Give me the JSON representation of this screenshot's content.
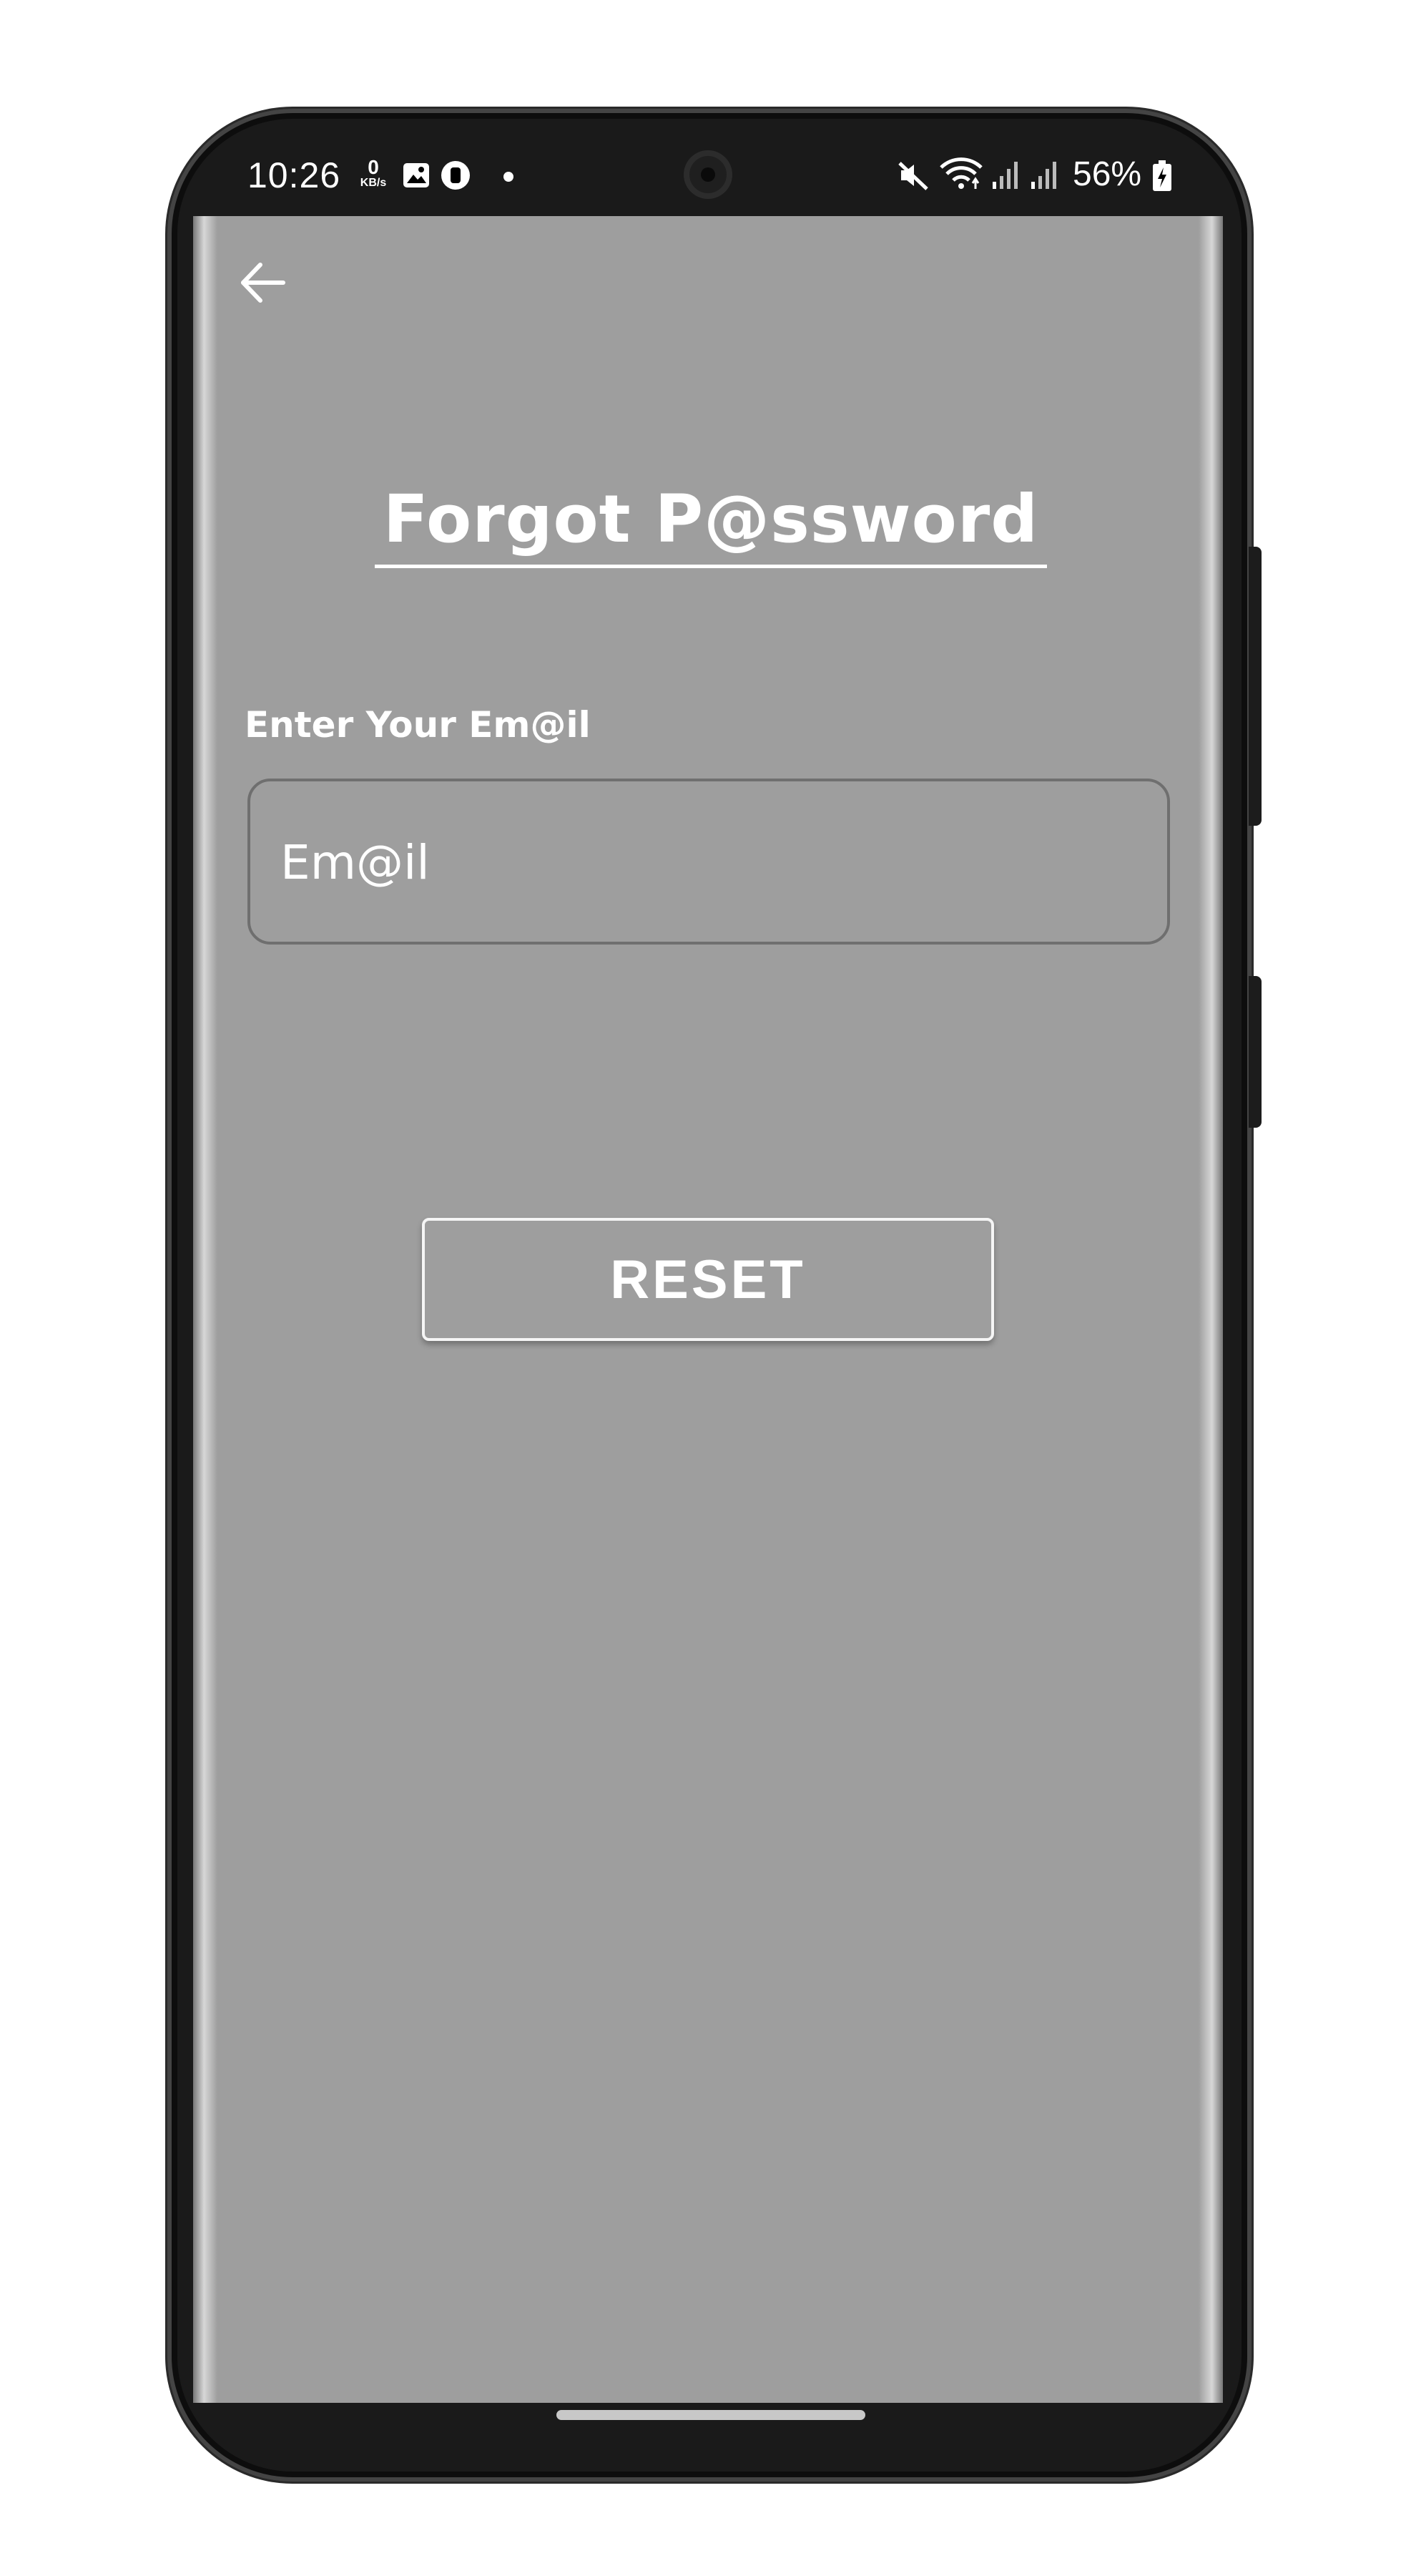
{
  "status_bar": {
    "time": "10:26",
    "net_speed_value": "0",
    "net_speed_unit": "KB/s",
    "battery_percent": "56%"
  },
  "screen": {
    "background_color": "#9e9e9e",
    "title": "Forgot P@ssword",
    "email_label": "Enter Your Em@il",
    "email_field": {
      "value": "",
      "placeholder": "Em@il"
    },
    "reset_button_label": "RESET"
  },
  "icons": {
    "back": "arrow-left-icon",
    "mute": "mute-icon",
    "wifi": "wifi-icon",
    "signal": "signal-icon",
    "battery": "battery-charging-icon",
    "gallery": "image-icon",
    "app": "app-notification-icon"
  }
}
